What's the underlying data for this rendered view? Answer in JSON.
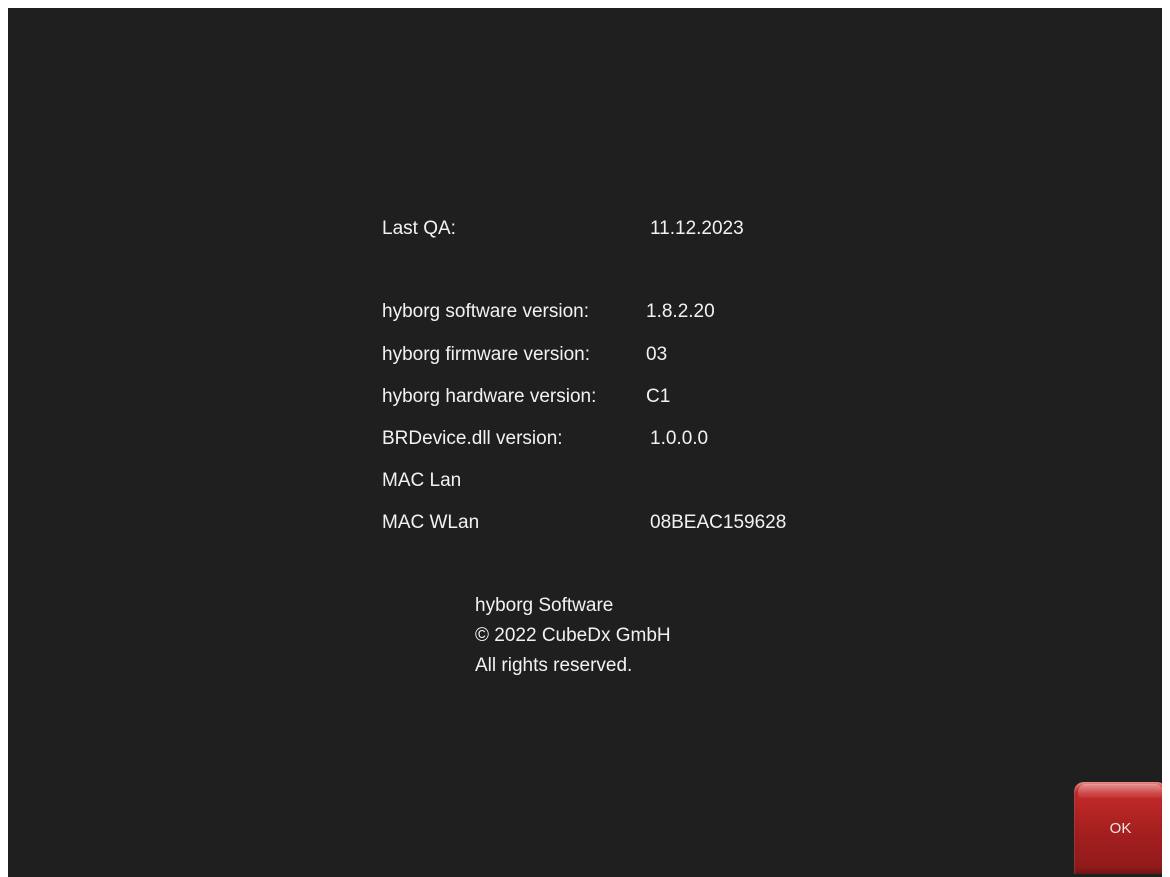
{
  "info": {
    "last_qa_label": "Last QA:",
    "last_qa_value": "11.12.2023",
    "software_label": "hyborg software version:",
    "software_value": "1.8.2.20",
    "firmware_label": "hyborg firmware version:",
    "firmware_value": "03",
    "hardware_label": "hyborg hardware version:",
    "hardware_value": "C1",
    "dll_label": "BRDevice.dll version:",
    "dll_value": "1.0.0.0",
    "mac_lan_label": "MAC Lan",
    "mac_lan_value": "",
    "mac_wlan_label": "MAC WLan",
    "mac_wlan_value": "08BEAC159628"
  },
  "copyright": {
    "line1": "hyborg Software",
    "line2": "© 2022 CubeDx GmbH",
    "line3": "All rights reserved."
  },
  "buttons": {
    "ok_label": "OK"
  },
  "colors": {
    "background": "#1f1f1f",
    "text": "#f2f2f2",
    "ok_button": "#a51f1f"
  }
}
